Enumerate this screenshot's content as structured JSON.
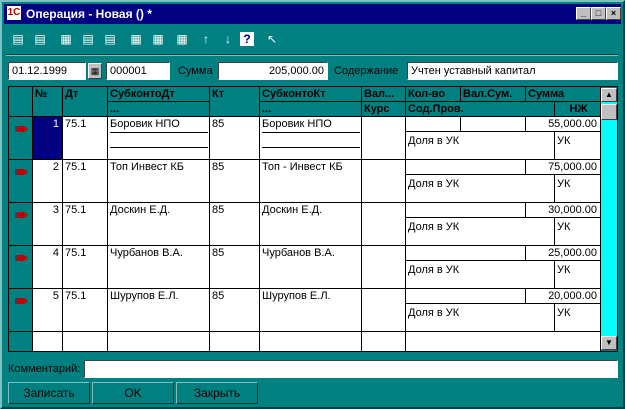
{
  "window": {
    "title": "Операция - Новая () *",
    "app_icon": "1C",
    "controls": [
      "_",
      "□",
      "×"
    ]
  },
  "toolbar": {
    "icons": [
      "add-row-icon",
      "copy-row-icon",
      "edit-row-icon",
      "insert-icon",
      "delete-row-icon",
      "group-icon",
      "ungroup-icon",
      "subtotal-icon",
      "move-up-icon",
      "move-down-icon",
      "help-icon",
      "context-help-icon"
    ],
    "glyphs": [
      "▤",
      "▤",
      "▦",
      "▤",
      "▤",
      "▦",
      "▦",
      "▦",
      "↑",
      "↓",
      "?",
      "↖"
    ]
  },
  "header": {
    "date": "01.12.1999",
    "calendar_glyph": "▦",
    "number": "000001",
    "sum_label": "Сумма",
    "sum_value": "205,000.00",
    "content_label": "Содержание",
    "content_value": "Учтен уставный капитал"
  },
  "grid": {
    "columns": {
      "num": "№",
      "dt": "Дт",
      "subconto_dt": "СубконтоДт",
      "subconto_dt_sub": "...",
      "kt": "Кт",
      "subconto_kt": "СубконтоКт",
      "subconto_kt_sub": "...",
      "currency": "Вал...",
      "rate": "Курс",
      "qty": "Кол-во",
      "cur_sum": "Вал.Сум.",
      "sum": "Сумма",
      "content": "Сод.Пров.",
      "nzh": "НЖ"
    },
    "rows": [
      {
        "n": "1",
        "dt": "75.1",
        "subdt": "Боровик НПО",
        "kt": "85",
        "subkt": "Боровик НПО",
        "sum": "55,000.00",
        "content": "Доля в УК",
        "nzh": "УК"
      },
      {
        "n": "2",
        "dt": "75.1",
        "subdt": "Топ Инвест КБ",
        "kt": "85",
        "subkt": "Топ - Инвест КБ",
        "sum": "75,000.00",
        "content": "Доля в УК",
        "nzh": "УК"
      },
      {
        "n": "3",
        "dt": "75.1",
        "subdt": "Доскин Е.Д.",
        "kt": "85",
        "subkt": "Доскин Е.Д.",
        "sum": "30,000.00",
        "content": "Доля в УК",
        "nzh": "УК"
      },
      {
        "n": "4",
        "dt": "75.1",
        "subdt": "Чурбанов В.А.",
        "kt": "85",
        "subkt": "Чурбанов В.А.",
        "sum": "25,000.00",
        "content": "Доля в УК",
        "nzh": "УК"
      },
      {
        "n": "5",
        "dt": "75.1",
        "subdt": "Шурупов Е.Л.",
        "kt": "85",
        "subkt": "Шурупов Е.Л.",
        "sum": "20,000.00",
        "content": "Доля в УК",
        "nzh": "УК"
      }
    ],
    "scroll_up": "▲",
    "scroll_down": "▼"
  },
  "comment": {
    "label": "Комментарий:",
    "value": ""
  },
  "buttons": {
    "save": "Записать",
    "ok": "OK",
    "close": "Закрыть"
  },
  "colors": {
    "background": "#008080",
    "title_bar": "#000080",
    "scrollbar": "#00ffff",
    "selection": "#000080"
  }
}
